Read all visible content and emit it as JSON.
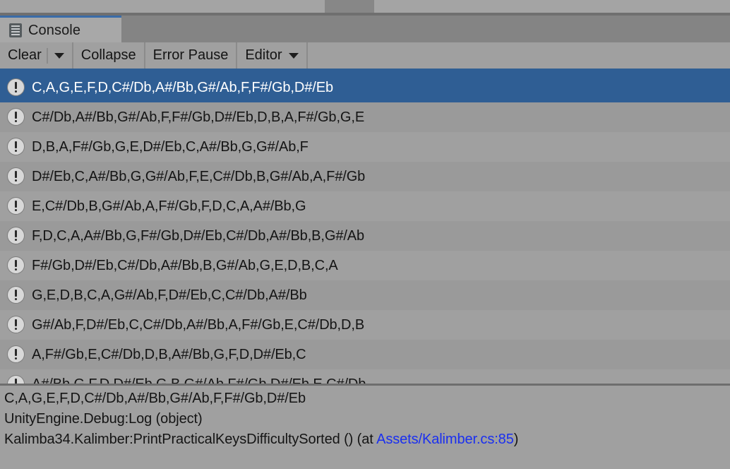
{
  "window": {
    "background_color": "#888888",
    "top_strip_color": "#a4a4a4",
    "accent_color": "#2f5e94",
    "panel_color": "#a0a0a0"
  },
  "tab": {
    "label": "Console",
    "icon": "console-icon",
    "active": true
  },
  "toolbar": {
    "clear_label": "Clear",
    "clear_dropdown_icon": "chevron-down-icon",
    "collapse_label": "Collapse",
    "error_pause_label": "Error Pause",
    "editor_label": "Editor",
    "editor_dropdown_icon": "chevron-down-icon"
  },
  "log_entries": [
    {
      "icon": "log-message-icon",
      "text": "C,A,G,E,F,D,C#/Db,A#/Bb,G#/Ab,F,F#/Gb,D#/Eb",
      "selected": true
    },
    {
      "icon": "log-message-icon",
      "text": "C#/Db,A#/Bb,G#/Ab,F,F#/Gb,D#/Eb,D,B,A,F#/Gb,G,E",
      "selected": false
    },
    {
      "icon": "log-message-icon",
      "text": "D,B,A,F#/Gb,G,E,D#/Eb,C,A#/Bb,G,G#/Ab,F",
      "selected": false
    },
    {
      "icon": "log-message-icon",
      "text": "D#/Eb,C,A#/Bb,G,G#/Ab,F,E,C#/Db,B,G#/Ab,A,F#/Gb",
      "selected": false
    },
    {
      "icon": "log-message-icon",
      "text": "E,C#/Db,B,G#/Ab,A,F#/Gb,F,D,C,A,A#/Bb,G",
      "selected": false
    },
    {
      "icon": "log-message-icon",
      "text": "F,D,C,A,A#/Bb,G,F#/Gb,D#/Eb,C#/Db,A#/Bb,B,G#/Ab",
      "selected": false
    },
    {
      "icon": "log-message-icon",
      "text": "F#/Gb,D#/Eb,C#/Db,A#/Bb,B,G#/Ab,G,E,D,B,C,A",
      "selected": false
    },
    {
      "icon": "log-message-icon",
      "text": "G,E,D,B,C,A,G#/Ab,F,D#/Eb,C,C#/Db,A#/Bb",
      "selected": false
    },
    {
      "icon": "log-message-icon",
      "text": "G#/Ab,F,D#/Eb,C,C#/Db,A#/Bb,A,F#/Gb,E,C#/Db,D,B",
      "selected": false
    },
    {
      "icon": "log-message-icon",
      "text": "A,F#/Gb,E,C#/Db,D,B,A#/Bb,G,F,D,D#/Eb,C",
      "selected": false
    },
    {
      "icon": "log-message-icon",
      "text": "A#/Bb,G,F,D,D#/Eb,G,B,G#/Ab,F#/Gb,D#/Eb,E,C#/Db",
      "selected": false
    }
  ],
  "detail": {
    "message": "C,A,G,E,F,D,C#/Db,A#/Bb,G#/Ab,F,F#/Gb,D#/Eb",
    "stack_line_1": "UnityEngine.Debug:Log (object)",
    "stack_line_2_prefix": "Kalimba34.Kalimber:PrintPracticalKeysDifficultySorted () (at ",
    "stack_link": "Assets/Kalimber.cs:85",
    "stack_line_2_suffix": ")"
  }
}
